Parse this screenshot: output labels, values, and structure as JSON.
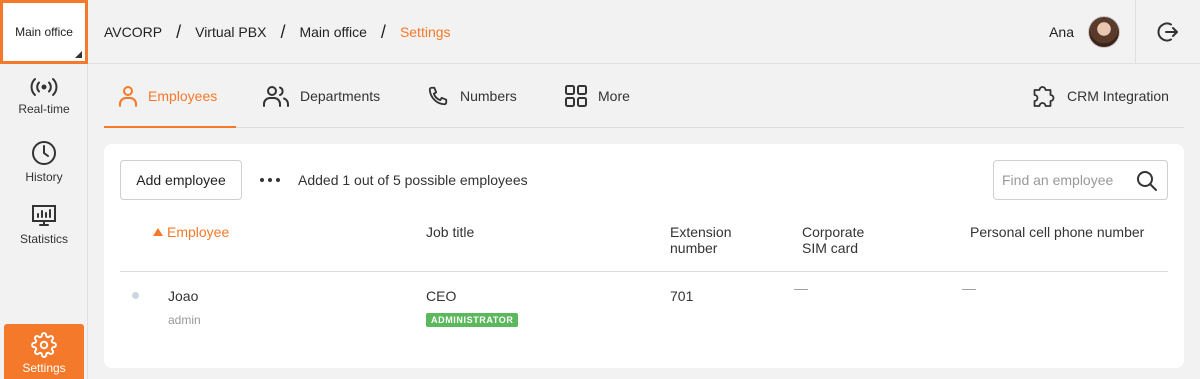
{
  "sidebar": {
    "office_label": "Main office",
    "items": [
      {
        "label": "Real-time",
        "icon": "broadcast-icon"
      },
      {
        "label": "History",
        "icon": "clock-icon"
      },
      {
        "label": "Statistics",
        "icon": "chart-icon"
      }
    ],
    "settings_label": "Settings"
  },
  "header": {
    "breadcrumb": [
      "AVCORP",
      "Virtual PBX",
      "Main office",
      "Settings"
    ],
    "separator": "/",
    "user_name": "Ana"
  },
  "tabs": {
    "employees": "Employees",
    "departments": "Departments",
    "numbers": "Numbers",
    "more": "More",
    "crm": "CRM Integration"
  },
  "toolbar": {
    "add_label": "Add employee",
    "count_text": "Added 1 out of 5 possible employees",
    "search_placeholder": "Find an employee"
  },
  "table": {
    "headers": {
      "employee": "Employee",
      "job_title": "Job title",
      "extension_1": "Extension",
      "extension_2": "number",
      "sim_1": "Corporate",
      "sim_2": "SIM card",
      "personal": "Personal cell phone number"
    },
    "rows": [
      {
        "name": "Joao",
        "login": "admin",
        "job_title": "CEO",
        "role_badge": "ADMINISTRATOR",
        "extension": "701",
        "sim": "—",
        "personal": "—"
      }
    ]
  },
  "colors": {
    "accent": "#f5792a",
    "badge": "#5cb85c",
    "background": "#f2f2f2"
  }
}
